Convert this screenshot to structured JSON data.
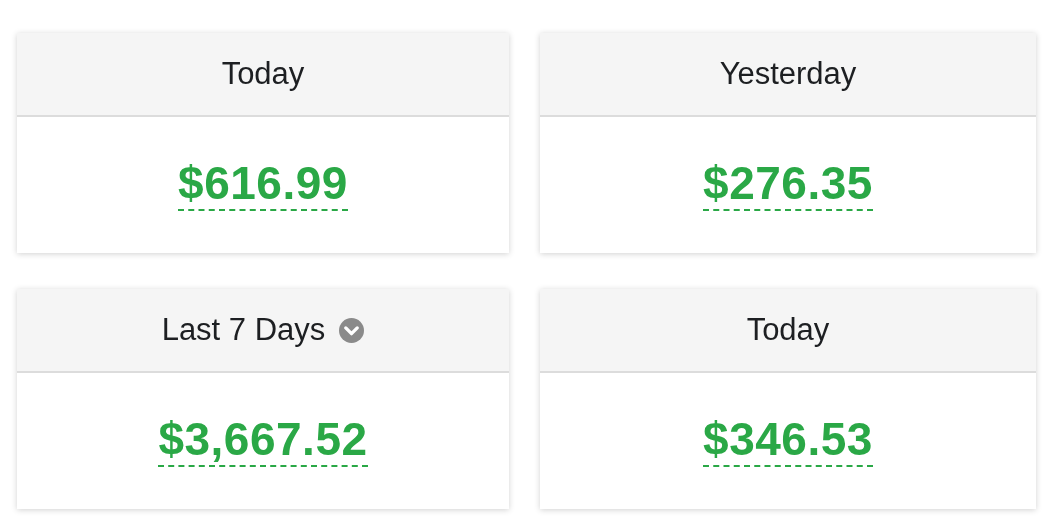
{
  "cards": [
    {
      "title": "Today",
      "value": "$616.99",
      "dropdown": false
    },
    {
      "title": "Yesterday",
      "value": "$276.35",
      "dropdown": false
    },
    {
      "title": "Last 7 Days",
      "value": "$3,667.52",
      "dropdown": true
    },
    {
      "title": "Today",
      "value": "$346.53",
      "dropdown": false
    }
  ]
}
